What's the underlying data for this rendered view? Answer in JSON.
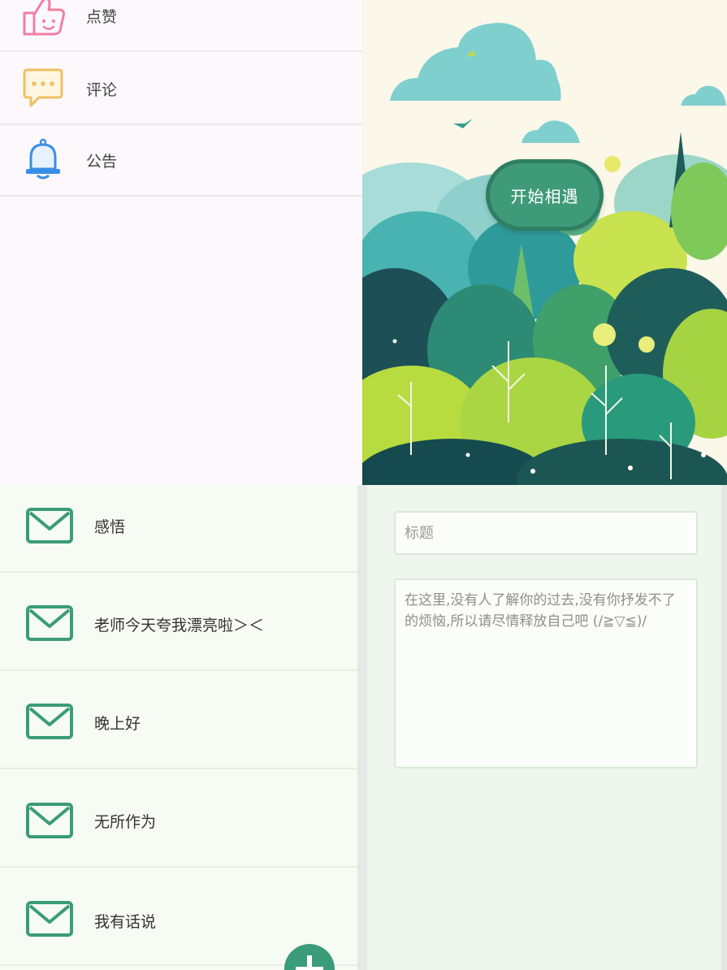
{
  "menu": {
    "items": [
      {
        "label": "点赞",
        "icon": "thumbs-up-icon"
      },
      {
        "label": "评论",
        "icon": "comment-bubble-icon"
      },
      {
        "label": "公告",
        "icon": "bell-icon"
      }
    ]
  },
  "welcome": {
    "start_button": "开始相遇",
    "illustration": "forest-illustration"
  },
  "letters": {
    "items": [
      {
        "title": "感悟",
        "icon": "envelope-icon"
      },
      {
        "title": "老师今天夸我漂亮啦＞＜",
        "icon": "envelope-icon"
      },
      {
        "title": "晚上好",
        "icon": "envelope-icon"
      },
      {
        "title": "无所作为",
        "icon": "envelope-icon"
      },
      {
        "title": "我有话说",
        "icon": "envelope-icon"
      }
    ],
    "fab_icon": "plus-icon"
  },
  "compose": {
    "title_placeholder": "标题",
    "content_placeholder": "在这里,没有人了解你的过去,没有你抒发不了的烦恼,所以请尽情释放自己吧 (/≧▽≦)/"
  },
  "colors": {
    "accent_green": "#3a9c78",
    "like_pink": "#f07fa3",
    "comment_yellow": "#f0c060",
    "bell_blue": "#3a8ee6"
  }
}
